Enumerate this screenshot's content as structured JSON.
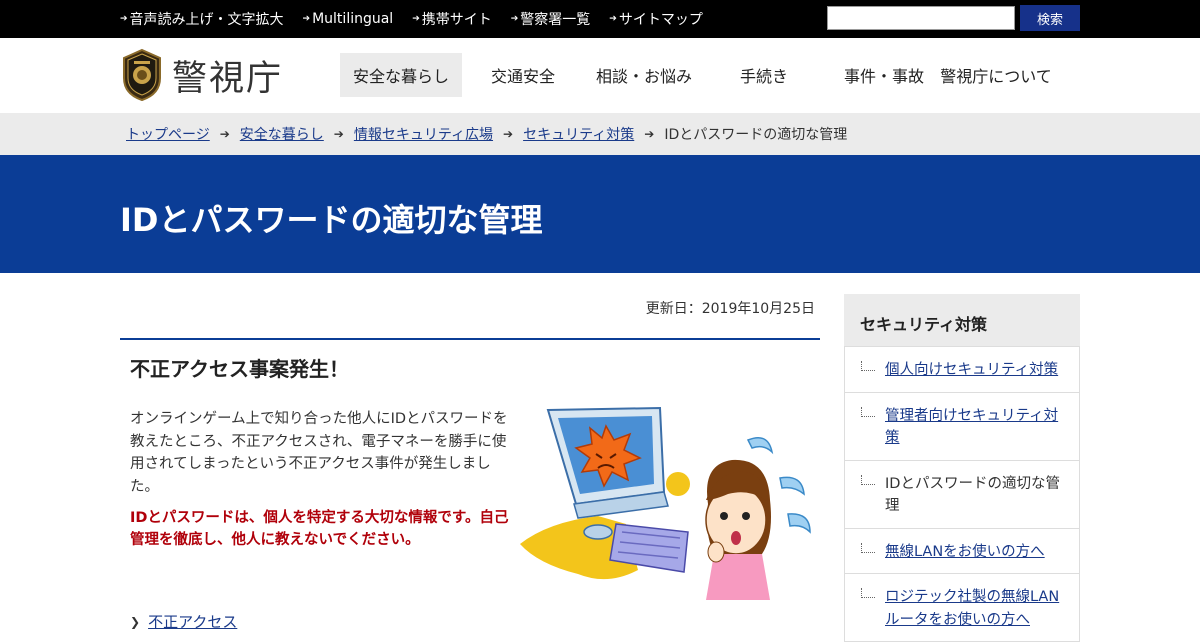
{
  "utility": {
    "links": [
      "音声読み上げ・文字拡大",
      "Multilingual",
      "携帯サイト",
      "警察署一覧",
      "サイトマップ"
    ],
    "search_placeholder": "",
    "search_button": "検索"
  },
  "header": {
    "logo_text": "警視庁",
    "nav": [
      {
        "label": "安全な暮らし",
        "active": true
      },
      {
        "label": "交通安全",
        "active": false
      },
      {
        "label": "相談・お悩み",
        "active": false
      },
      {
        "label": "手続き",
        "active": false
      },
      {
        "label": "事件・事故",
        "active": false
      },
      {
        "label": "警視庁について",
        "active": false
      }
    ]
  },
  "breadcrumb": {
    "items": [
      "トップページ",
      "安全な暮らし",
      "情報セキュリティ広場",
      "セキュリティ対策"
    ],
    "current": "IDとパスワードの適切な管理"
  },
  "page": {
    "title": "IDとパスワードの適切な管理",
    "updated": "更新日：2019年10月25日"
  },
  "article": {
    "heading": "不正アクセス事案発生！",
    "body": "オンラインゲーム上で知り合った他人にIDとパスワードを教えたところ、不正アクセスされ、電子マネーを勝手に使用されてしまったという不正アクセス事件が発生しました。",
    "warning": "IDとパスワードは、個人を特定する大切な情報です。自己管理を徹底し、他人に教えないでください。",
    "related_link": "不正アクセス"
  },
  "sidebar": {
    "heading": "セキュリティ対策",
    "items": [
      {
        "label": "個人向けセキュリティ対策",
        "current": false
      },
      {
        "label": "管理者向けセキュリティ対策",
        "current": false
      },
      {
        "label": "IDとパスワードの適切な管理",
        "current": true
      },
      {
        "label": "無線LANをお使いの方へ",
        "current": false
      },
      {
        "label": "ロジテック社製の無線LANルータをお使いの方へ",
        "current": false
      }
    ]
  },
  "colors": {
    "brand_blue": "#0b3d96",
    "search_button": "#16318a",
    "warning_red": "#b0000a",
    "link": "#1a3a8a"
  }
}
